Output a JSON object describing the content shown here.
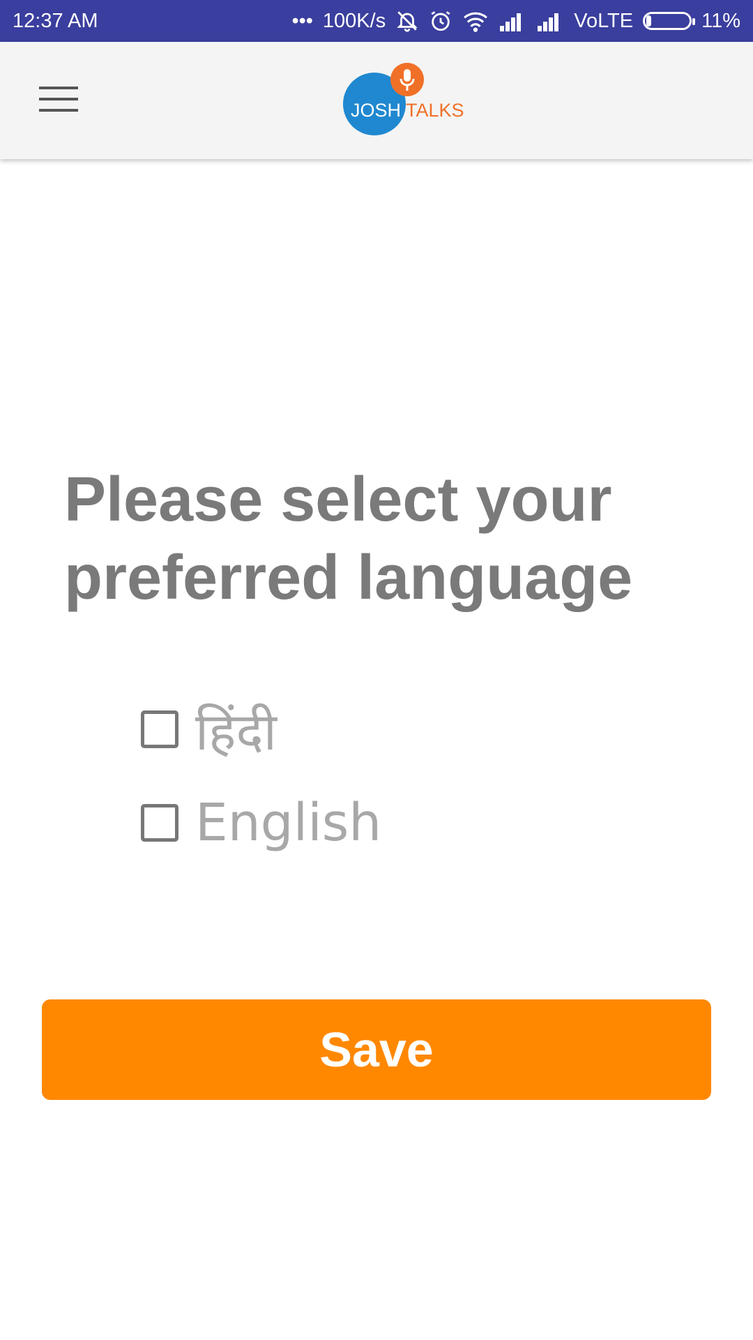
{
  "status_bar": {
    "time": "12:37 AM",
    "dots": "•••",
    "network_speed": "100K/s",
    "carrier_label": "VoLTE",
    "battery_percent": "11%",
    "battery_level": 0.11,
    "icons": [
      "mute-vibrate-icon",
      "alarm-icon",
      "wifi-icon",
      "signal-icon",
      "signal-icon",
      "battery-icon"
    ]
  },
  "app_bar": {
    "logo_josh": "JOSH",
    "logo_talks": "TALKS",
    "colors": {
      "background": "#f4f4f4",
      "logo_blue": "#2088d0",
      "logo_orange": "#f07028"
    }
  },
  "main": {
    "title": "Please select your preferred language",
    "options": [
      {
        "label": "हिंदी",
        "checked": false
      },
      {
        "label": "English",
        "checked": false
      }
    ],
    "save_label": "Save",
    "colors": {
      "title": "#7a7a7a",
      "option_text": "#a8a8a8",
      "save_button": "#ff8800"
    }
  }
}
